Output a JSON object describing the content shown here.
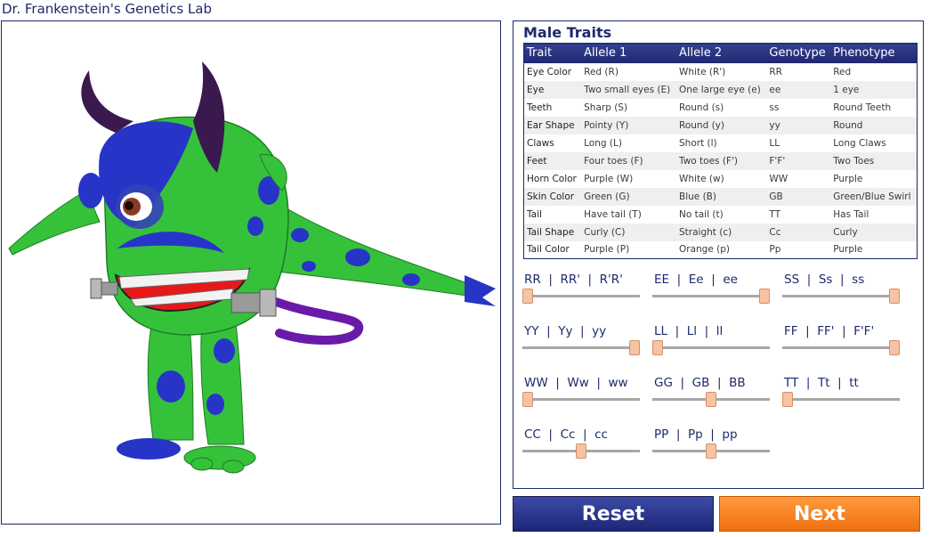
{
  "app": {
    "title": "Dr. Frankenstein's Genetics Lab"
  },
  "panel": {
    "title": "Male Traits",
    "columns": [
      "Trait",
      "Allele 1",
      "Allele 2",
      "Genotype",
      "Phenotype"
    ],
    "rows": [
      [
        "Eye Color",
        "Red (R)",
        "White (R')",
        "RR",
        "Red"
      ],
      [
        "Eye",
        "Two small eyes (E)",
        "One large eye (e)",
        "ee",
        "1 eye"
      ],
      [
        "Teeth",
        "Sharp (S)",
        "Round (s)",
        "ss",
        "Round Teeth"
      ],
      [
        "Ear Shape",
        "Pointy (Y)",
        "Round (y)",
        "yy",
        "Round"
      ],
      [
        "Claws",
        "Long (L)",
        "Short (l)",
        "LL",
        "Long Claws"
      ],
      [
        "Feet",
        "Four toes (F)",
        "Two toes (F')",
        "F'F'",
        "Two Toes"
      ],
      [
        "Horn Color",
        "Purple (W)",
        "White (w)",
        "WW",
        "Purple"
      ],
      [
        "Skin Color",
        "Green (G)",
        "Blue (B)",
        "GB",
        "Green/Blue Swirl"
      ],
      [
        "Tail",
        "Have tail (T)",
        "No tail (t)",
        "TT",
        "Has Tail"
      ],
      [
        "Tail Shape",
        "Curly (C)",
        "Straight (c)",
        "Cc",
        "Curly"
      ],
      [
        "Tail Color",
        "Purple (P)",
        "Orange (p)",
        "Pp",
        "Purple"
      ]
    ]
  },
  "sliders": [
    {
      "name": "eye-color",
      "label": "RR  |  RR'  |  R'R'",
      "value": 0
    },
    {
      "name": "eye-count",
      "label": "EE  |  Ee  |  ee",
      "value": 2
    },
    {
      "name": "teeth",
      "label": "SS  |  Ss  |  ss",
      "value": 2
    },
    {
      "name": "ear-shape",
      "label": "YY  |  Yy  |  yy",
      "value": 2
    },
    {
      "name": "claws",
      "label": "LL  |  Ll  |  ll",
      "value": 0
    },
    {
      "name": "feet",
      "label": "FF  |  FF'  |  F'F'",
      "value": 2
    },
    {
      "name": "horn-color",
      "label": "WW  |  Ww  |  ww",
      "value": 0
    },
    {
      "name": "skin-color",
      "label": "GG  |  GB  |  BB",
      "value": 1
    },
    {
      "name": "tail",
      "label": "TT  |  Tt  |  tt",
      "value": 0
    },
    {
      "name": "tail-shape",
      "label": "CC  |  Cc  |  cc",
      "value": 1
    },
    {
      "name": "tail-color",
      "label": "PP  |  Pp  |  pp",
      "value": 1
    }
  ],
  "buttons": {
    "reset": "Reset",
    "next": "Next"
  },
  "colors": {
    "navy": "#1d2a6b",
    "skin_green": "#35c23a",
    "skin_blue": "#2734c8",
    "horn": "#3a1a4e",
    "tail": "#6a1aa8",
    "next_orange": "#f58220"
  }
}
